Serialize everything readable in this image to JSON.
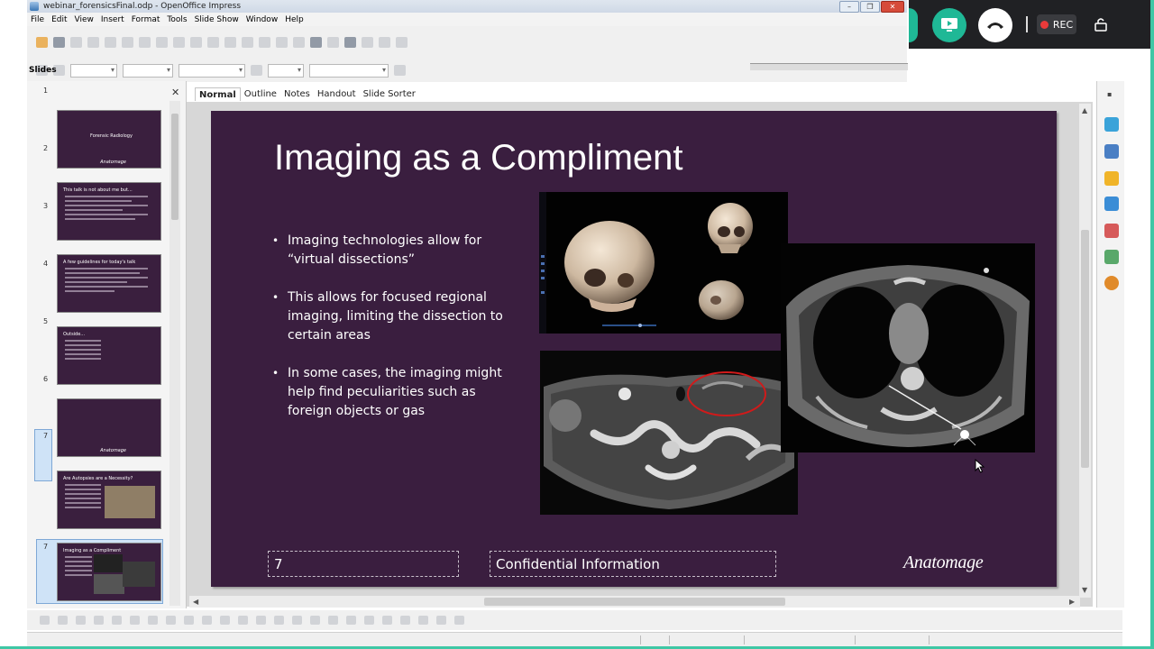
{
  "window": {
    "title": "webinar_forensicsFinal.odp - OpenOffice Impress",
    "controls": [
      "–",
      "❐",
      "✕"
    ]
  },
  "menu": [
    "File",
    "Edit",
    "View",
    "Insert",
    "Format",
    "Tools",
    "Slide Show",
    "Window",
    "Help"
  ],
  "meeting_bar": {
    "rec_label": "REC",
    "colors": {
      "share": "#1fb896",
      "rec_dot": "#ea3a3a",
      "accent_border": "#3fc7a5"
    }
  },
  "slides_pane": {
    "label": "Slides",
    "close": "✕",
    "numbers": [
      "1",
      "2",
      "3",
      "4",
      "5",
      "6",
      "7",
      "7"
    ],
    "thumbnails": [
      {
        "title": "Forensic Radiology",
        "brand": "Anatomage"
      },
      {
        "title": "This talk is not about me but...",
        "brand": ""
      },
      {
        "title": "A few guidelines for today's talk",
        "brand": ""
      },
      {
        "title": "Outside...",
        "brand": ""
      },
      {
        "title": "",
        "brand": "Anatomage"
      },
      {
        "title": "Are Autopsies are a Necessity?",
        "brand": ""
      },
      {
        "title": "Imaging as a Compliment",
        "brand": ""
      }
    ]
  },
  "view_tabs": [
    "Normal",
    "Outline",
    "Notes",
    "Handout",
    "Slide Sorter"
  ],
  "slide": {
    "title": "Imaging as a Compliment",
    "bullets": [
      "Imaging technologies allow for “virtual dissections”",
      "This allows for focused regional imaging, limiting the dissection to certain areas",
      "In some cases, the imaging might help find peculiarities such as foreign objects or gas"
    ],
    "page_number": "7",
    "footer": "Confidential Information",
    "brand": "Anatomage",
    "background_color": "#3a1e3f"
  }
}
